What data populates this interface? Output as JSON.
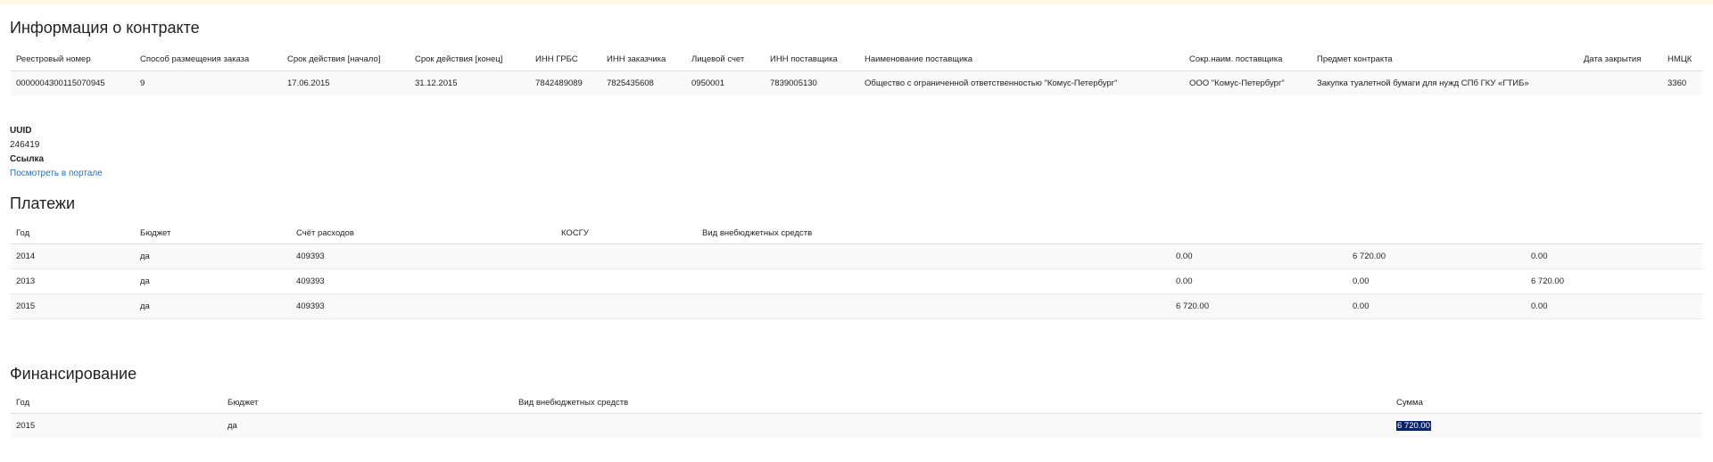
{
  "contract_info": {
    "title": "Информация о контракте",
    "columns": [
      "Реестровый номер",
      "Способ размещения заказа",
      "Срок действия [начало]",
      "Срок действия [конец]",
      "ИНН ГРБС",
      "ИНН заказчика",
      "Лицевой счет",
      "ИНН поставщика",
      "Наименование поставщика",
      "Сокр.наим. поставщика",
      "Предмет контракта",
      "Дата закрытия",
      "НМЦК"
    ],
    "row": [
      "0000004300115070945",
      "9",
      "17.06.2015",
      "31.12.2015",
      "7842489089",
      "7825435608",
      "0950001",
      "7839005130",
      "Общество с ограниченной ответственностью \"Комус-Петербург\"",
      "ООО \"Комус-Петербург\"",
      "Закупка туалетной бумаги для нужд СПб ГКУ «ГТИБ»",
      "",
      "3360"
    ]
  },
  "uuid": {
    "label": "UUID",
    "value": "246419",
    "link_label": "Ссылка",
    "link_text": "Посмотреть в портале"
  },
  "payments": {
    "title": "Платежи",
    "columns": [
      "Год",
      "Бюджет",
      "Счёт расходов",
      "КОСГУ",
      "Вид внебюджетных средств",
      "",
      "",
      ""
    ],
    "rows": [
      [
        "2014",
        "да",
        "409393",
        "",
        "",
        "0.00",
        "6 720.00",
        "0.00"
      ],
      [
        "2013",
        "да",
        "409393",
        "",
        "",
        "0.00",
        "0.00",
        "6 720.00"
      ],
      [
        "2015",
        "да",
        "409393",
        "",
        "",
        "6 720.00",
        "0.00",
        "0.00"
      ]
    ]
  },
  "funding": {
    "title": "Финансирование",
    "columns": [
      "Год",
      "Бюджет",
      "Вид внебюджетных средств",
      "Сумма"
    ],
    "row": [
      "2015",
      "да",
      "",
      "6 720.00"
    ]
  },
  "colors": {
    "notice_bar": "#fcf8e3",
    "link": "#2a6fb0",
    "selection": "#0a246a",
    "row_stripe": "#f9f9f9"
  }
}
